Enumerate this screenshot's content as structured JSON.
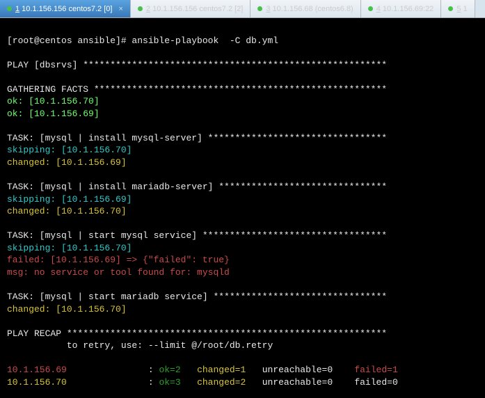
{
  "tabs": [
    {
      "label": "1 10.1.156.156 centos7.2 [0]",
      "u": "1",
      "rest": " 10.1.156.156 centos7.2 [0]",
      "active": true
    },
    {
      "label": "2 10.1.156.156 centos7.2 [2]",
      "u": "2",
      "rest": " 10.1.156.156 centos7.2 [2]",
      "active": false
    },
    {
      "label": "3 10.1.156.68 (centos6.8)",
      "u": "3",
      "rest": " 10.1.156.68 (centos6.8)",
      "active": false
    },
    {
      "label": "4 10.1.156.69:22",
      "u": "4",
      "rest": " 10.1.156.69:22",
      "active": false
    },
    {
      "label": "5 1",
      "u": "5",
      "rest": " 1",
      "active": false
    }
  ],
  "term": {
    "prompt": "[root@centos ansible]# ansible-playbook  -C db.yml",
    "play_header": "PLAY [dbsrvs] ********************************************************",
    "gathering_header": "GATHERING FACTS ******************************************************",
    "ok_70": "ok: [10.1.156.70]",
    "ok_69": "ok: [10.1.156.69]",
    "task1_header": "TASK: [mysql | install mysql-server] *********************************",
    "skip_70": "skipping: [10.1.156.70]",
    "changed_69": "changed: [10.1.156.69]",
    "task2_header": "TASK: [mysql | install mariadb-server] *******************************",
    "skip_69": "skipping: [10.1.156.69]",
    "changed_70": "changed: [10.1.156.70]",
    "task3_header": "TASK: [mysql | start mysql service] **********************************",
    "failed_69": "failed: [10.1.156.69] => {\"failed\": true}",
    "failed_msg": "msg: no service or tool found for: mysqld",
    "task4_header": "TASK: [mysql | start mariadb service] ********************************",
    "recap_header": "PLAY RECAP ***********************************************************",
    "retry_line": "           to retry, use: --limit @/root/db.retry",
    "recap": {
      "row1": {
        "host": "10.1.156.69",
        "sep": "               : ",
        "ok": "ok=2",
        "changed": "   changed=1",
        "unreach": "   unreachable=0",
        "failed": "    failed=1"
      },
      "row2": {
        "host": "10.1.156.70",
        "sep": "               : ",
        "ok": "ok=3",
        "changed": "   changed=2",
        "unreach": "   unreachable=0",
        "failed": "    failed=0"
      }
    }
  }
}
